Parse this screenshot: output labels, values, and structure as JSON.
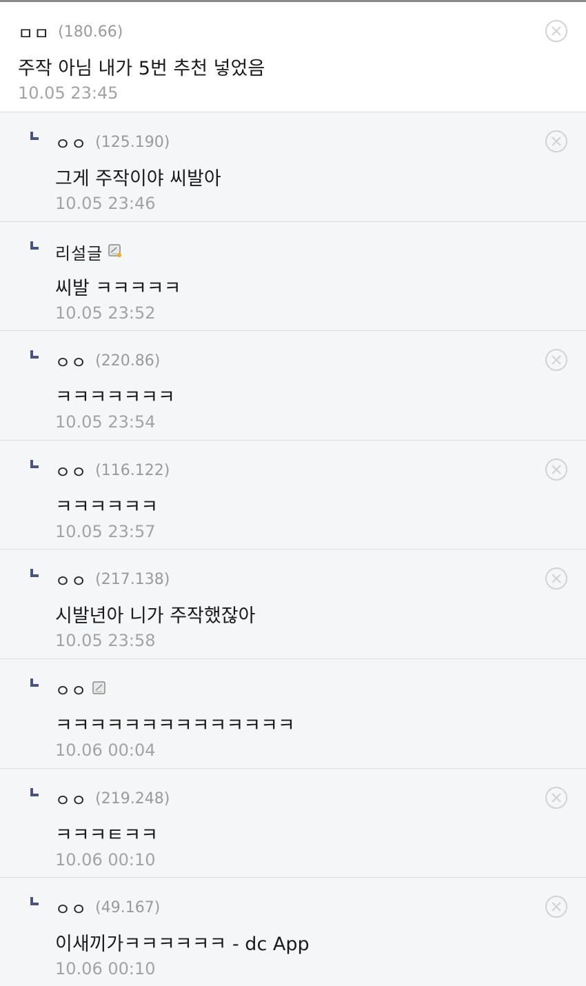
{
  "comments": [
    {
      "nick": "ㅁㅁ",
      "ip": "(180.66)",
      "text": "주작 아님 내가 5번 추천 넣었음",
      "time": "10.05 23:45"
    },
    {
      "nick": "ㅇㅇ",
      "ip": "(125.190)",
      "text": "그게 주작이야 씨발아",
      "time": "10.05 23:46"
    },
    {
      "nick": "리설글",
      "text": "씨발 ㅋㅋㅋㅋㅋ",
      "time": "10.05 23:52",
      "icon": "fixed-nick-member-icon"
    },
    {
      "nick": "ㅇㅇ",
      "ip": "(220.86)",
      "text": "ㅋㅋㅋㅋㅋㅋㅋ",
      "time": "10.05 23:54"
    },
    {
      "nick": "ㅇㅇ",
      "ip": "(116.122)",
      "text": "ㅋㅋㅋㅋㅋㅋ",
      "time": "10.05 23:57"
    },
    {
      "nick": "ㅇㅇ",
      "ip": "(217.138)",
      "text": "시발년아 니가 주작했잖아",
      "time": "10.05 23:58"
    },
    {
      "nick": "ㅇㅇ",
      "text": "ㅋㅋㅋㅋㅋㅋㅋㅋㅋㅋㅋㅋㅋㅋ",
      "time": "10.06 00:04",
      "icon": "semi-fixed-nick-member-icon"
    },
    {
      "nick": "ㅇㅇ",
      "ip": "(219.248)",
      "text": "ㅋㅋㅋㅌㅋㅋ",
      "time": "10.06 00:10"
    },
    {
      "nick": "ㅇㅇ",
      "ip": "(49.167)",
      "text": "이새끼가ㅋㅋㅋㅋㅋㅋ - dc App",
      "time": "10.06 00:10"
    }
  ],
  "icons": {
    "delete": "circle-x-icon",
    "reply": "reply-arrow-icon"
  },
  "colors": {
    "reply_background": "#f5f6f8",
    "reply_mark": "#4a5480",
    "timestamp": "#a3a3a3",
    "ip": "#9a9a9a"
  }
}
